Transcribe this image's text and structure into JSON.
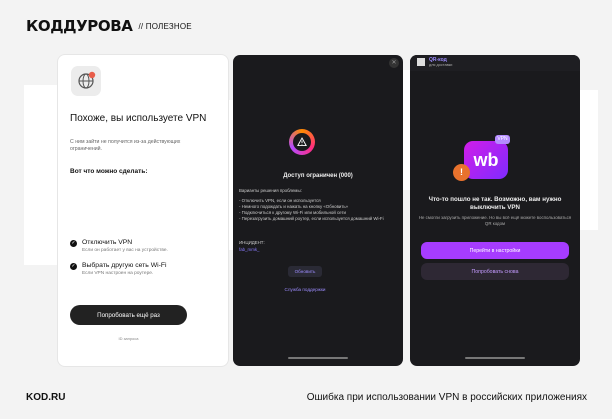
{
  "header": {
    "logo": "КОДДУРОВА",
    "section": "// ПОЛЕЗНОЕ"
  },
  "footer": {
    "site": "KOD.RU",
    "caption": "Ошибка при использовании VPN в российских приложениях"
  },
  "screen1": {
    "title": "Похоже, вы используете VPN",
    "subtitle": "С ним зайти не получится из-за действующих ограничений.",
    "what_to_do": "Вот что можно сделать:",
    "options": [
      {
        "label": "Отключить VPN",
        "desc": "Если он работает у вас на устройстве."
      },
      {
        "label": "Выбрать другую сеть Wi-Fi",
        "desc": "Если VPN настроен на роутере."
      }
    ],
    "retry_button": "Попробовать ещё раз",
    "footnote": "ID запроса"
  },
  "screen2": {
    "title": "Доступ ограничен (000)",
    "intro": "Варианты решения проблемы:",
    "items": [
      "- Отключить VPN, если он используется",
      "- Немного подождать и нажать на кнопку «Обновить»",
      "- Подключиться к другому Wi-Fi или мобильной сети",
      "- Перезагрузить домашний роутер, если используется домашний Wi-Fi"
    ],
    "incident_label": "ИНЦИДЕНТ:",
    "incident_value": "fab_mmk_",
    "refresh_button": "Обновить",
    "support_link": "Служба поддержки"
  },
  "screen3": {
    "qr_title": "QR-код",
    "qr_sub": "для доставки",
    "app_badge": "wb",
    "vpn_badge": "VPN",
    "alert_glyph": "!",
    "title": "Что-то пошло не так. Возможно, вам нужно выключить VPN",
    "subtitle": "Не смогли загрузить приложение. Но вы всё ещё можете воспользоваться QR кодом",
    "settings_button": "Перейти в настройки",
    "retry_button": "Попробовать снова"
  }
}
